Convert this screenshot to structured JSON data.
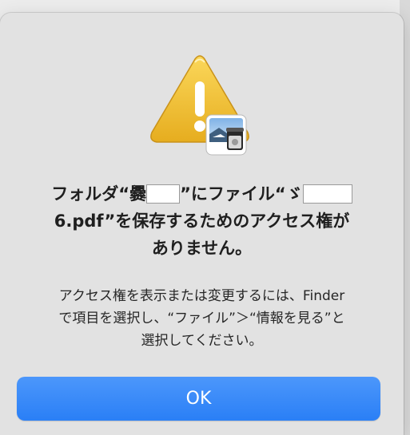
{
  "dialog": {
    "title_line1_a": "フォルダ“爨",
    "title_line1_b": "”にファイル“ゞ",
    "title_line2": "6.pdf”を保存するためのアクセス権が",
    "title_line3": "ありません。",
    "body_line1": "アクセス権を表示または変更するには、Finder",
    "body_line2": "で項目を選択し、“ファイル”＞“情報を見る”と",
    "body_line3": "選択してください。",
    "ok_label": "OK"
  },
  "icons": {
    "warning": "warning-icon",
    "app_badge": "preview-app-icon"
  },
  "colors": {
    "accent": "#2a7ff6",
    "warning_yellow": "#f4c534",
    "dialog_bg": "#e2e2e2"
  }
}
